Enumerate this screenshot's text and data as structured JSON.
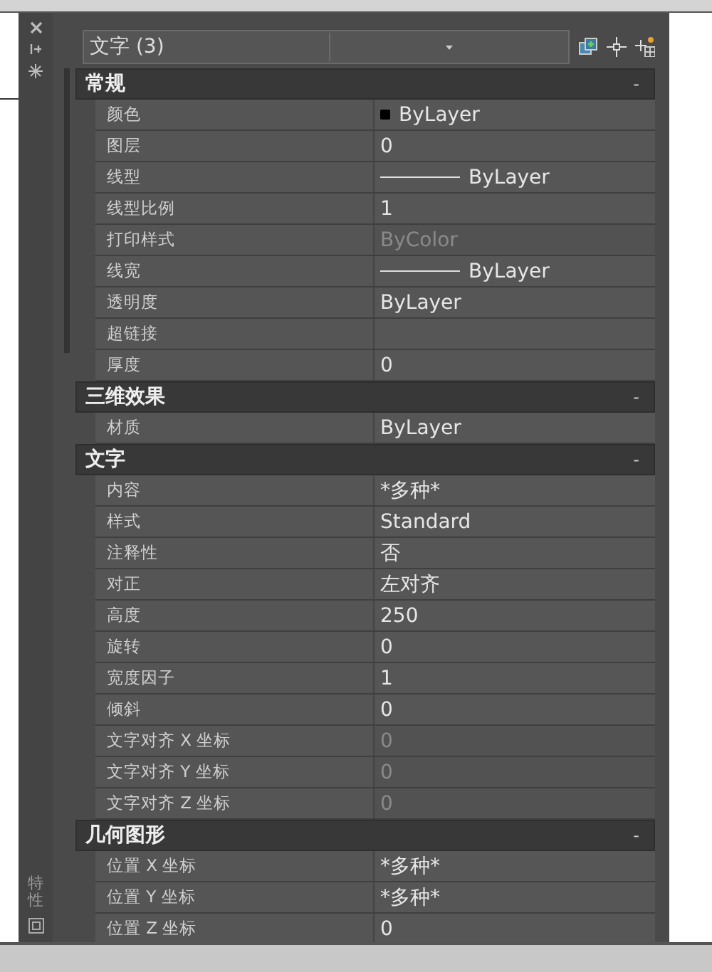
{
  "palette": {
    "side_label": "特性",
    "selector": {
      "value": "文字 (3)"
    },
    "sections": [
      {
        "title": "常规",
        "toggle": "-",
        "rows": [
          {
            "label": "颜色",
            "value": "ByLayer",
            "kind": "swatch",
            "disabled": false
          },
          {
            "label": "图层",
            "value": "0",
            "kind": "text",
            "disabled": false
          },
          {
            "label": "线型",
            "value": "ByLayer",
            "kind": "line",
            "disabled": false
          },
          {
            "label": "线型比例",
            "value": "1",
            "kind": "text",
            "disabled": false
          },
          {
            "label": "打印样式",
            "value": "ByColor",
            "kind": "text",
            "disabled": true
          },
          {
            "label": "线宽",
            "value": "ByLayer",
            "kind": "line",
            "disabled": false
          },
          {
            "label": "透明度",
            "value": "ByLayer",
            "kind": "text",
            "disabled": false
          },
          {
            "label": "超链接",
            "kind": "text"
          },
          {
            "label": "厚度",
            "value": "0",
            "kind": "text",
            "disabled": false
          }
        ]
      },
      {
        "title": "三维效果",
        "toggle": "-",
        "rows": [
          {
            "label": "材质",
            "value": "ByLayer",
            "kind": "text",
            "disabled": false
          }
        ]
      },
      {
        "title": "文字",
        "toggle": "-",
        "rows": [
          {
            "label": "内容",
            "value": "*多种*",
            "kind": "text",
            "disabled": false
          },
          {
            "label": "样式",
            "value": "Standard",
            "kind": "text",
            "disabled": false
          },
          {
            "label": "注释性",
            "value": "否",
            "kind": "text",
            "disabled": false
          },
          {
            "label": "对正",
            "value": "左对齐",
            "kind": "text",
            "disabled": false
          },
          {
            "label": "高度",
            "value": "250",
            "kind": "text",
            "disabled": false
          },
          {
            "label": "旋转",
            "value": "0",
            "kind": "text",
            "disabled": false
          },
          {
            "label": "宽度因子",
            "value": "1",
            "kind": "text",
            "disabled": false
          },
          {
            "label": "倾斜",
            "value": "0",
            "kind": "text",
            "disabled": false
          },
          {
            "label": "文字对齐 X 坐标",
            "value": "0",
            "kind": "text",
            "disabled": true
          },
          {
            "label": "文字对齐 Y 坐标",
            "value": "0",
            "kind": "text",
            "disabled": true
          },
          {
            "label": "文字对齐 Z 坐标",
            "value": "0",
            "kind": "text",
            "disabled": true
          }
        ]
      },
      {
        "title": "几何图形",
        "toggle": "-",
        "rows": [
          {
            "label": "位置 X 坐标",
            "value": "*多种*",
            "kind": "text",
            "disabled": false
          },
          {
            "label": "位置 Y 坐标",
            "value": "*多种*",
            "kind": "text",
            "disabled": false
          },
          {
            "label": "位置 Z 坐标",
            "value": "0",
            "kind": "text",
            "disabled": false
          }
        ]
      }
    ]
  }
}
